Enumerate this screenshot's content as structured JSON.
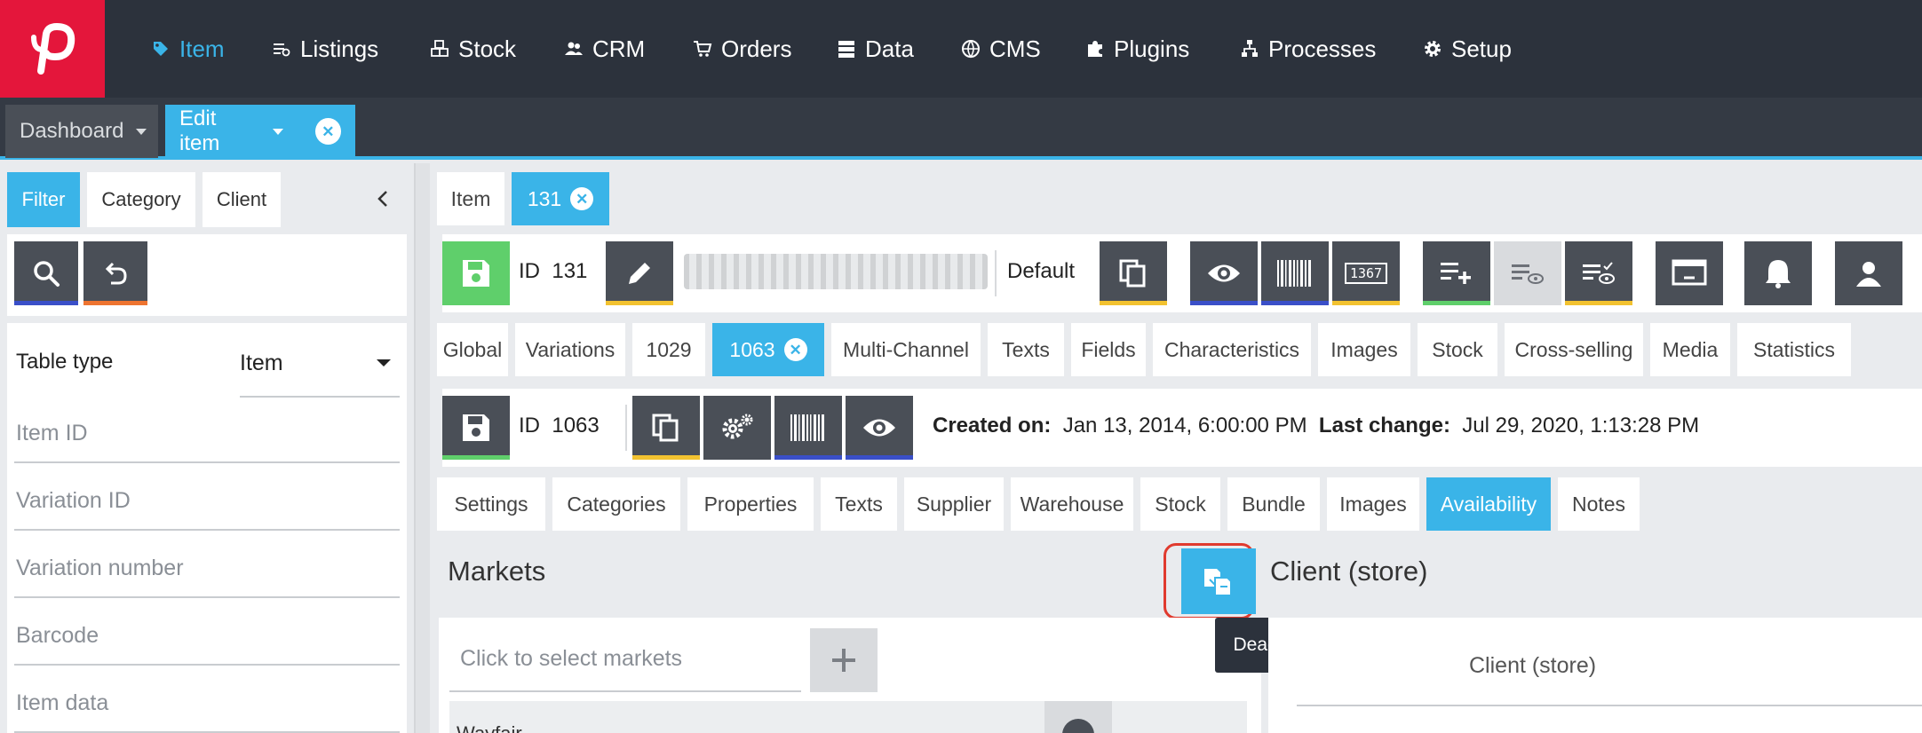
{
  "colors": {
    "brand": "#e4163b",
    "accent": "#3ab4e8",
    "nav_bg": "#2c323c",
    "green": "#5fcf6b",
    "yellow": "#f2c230",
    "blue": "#3a4fc8",
    "orange": "#ee7430",
    "red_highlight": "#e03a2e"
  },
  "topnav": {
    "items": [
      {
        "label": "Item",
        "icon": "tag-icon"
      },
      {
        "label": "Listings",
        "icon": "listings-icon"
      },
      {
        "label": "Stock",
        "icon": "boxes-icon"
      },
      {
        "label": "CRM",
        "icon": "users-icon"
      },
      {
        "label": "Orders",
        "icon": "cart-icon"
      },
      {
        "label": "Data",
        "icon": "database-icon"
      },
      {
        "label": "CMS",
        "icon": "globe-icon"
      },
      {
        "label": "Plugins",
        "icon": "puzzle-icon"
      },
      {
        "label": "Processes",
        "icon": "processes-icon"
      },
      {
        "label": "Setup",
        "icon": "gear-icon"
      }
    ]
  },
  "viewbar": {
    "dashboard": "Dashboard",
    "edit_item": "Edit item"
  },
  "left": {
    "tabs": [
      "Filter",
      "Category",
      "Client"
    ],
    "table_type_label": "Table type",
    "table_type_value": "Item",
    "fields": [
      "Item ID",
      "Variation ID",
      "Variation number",
      "Barcode",
      "Item data"
    ]
  },
  "item_tabs": {
    "item": "Item",
    "id_tab": "131"
  },
  "item_toolbar": {
    "id_prefix": "ID",
    "id_value": "131",
    "default_label": "Default",
    "barcode_count": "1367"
  },
  "variation_tabs": [
    "Global",
    "Variations",
    "1029",
    "1063",
    "Multi-Channel",
    "Texts",
    "Fields",
    "Characteristics",
    "Images",
    "Stock",
    "Cross-selling",
    "Media",
    "Statistics"
  ],
  "variation_toolbar": {
    "id_prefix": "ID",
    "id_value": "1063",
    "created_label": "Created on:",
    "created_value": "Jan 13, 2014, 6:00:00 PM",
    "changed_label": "Last change:",
    "changed_value": "Jul 29, 2020, 1:13:28 PM"
  },
  "sub_tabs": [
    "Settings",
    "Categories",
    "Properties",
    "Texts",
    "Supplier",
    "Warehouse",
    "Stock",
    "Bundle",
    "Images",
    "Availability",
    "Notes"
  ],
  "markets": {
    "title": "Markets",
    "select_placeholder": "Click to select markets",
    "tooltip": "Deactivate Inheritance",
    "row_partial": "Wayfair"
  },
  "client": {
    "title": "Client (store)",
    "column_header": "Client (store)"
  }
}
